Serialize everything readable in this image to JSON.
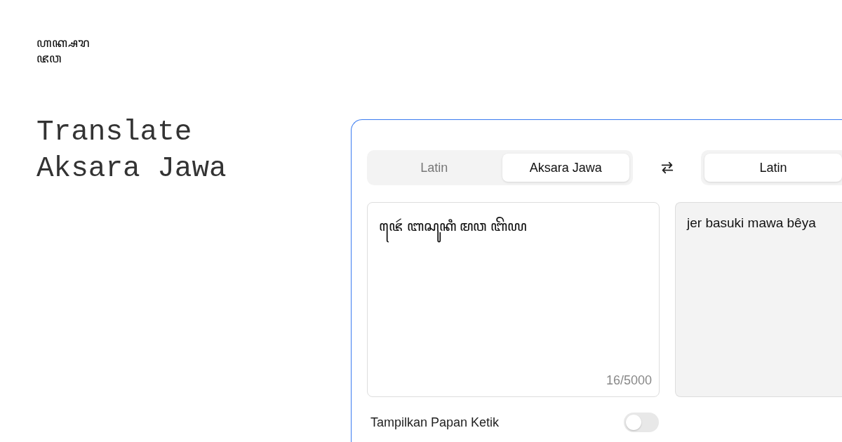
{
  "logo": {
    "line_1": "ꦲꦏ꧀ꦱꦫ",
    "line_2": "ꦗꦮ"
  },
  "headline": [
    "Translate",
    "Aksara Jawa"
  ],
  "source_tabs": [
    {
      "label": "Latin",
      "selected": false
    },
    {
      "label": "Aksara Jawa",
      "selected": true
    }
  ],
  "target_tabs": [
    {
      "label": "Latin",
      "selected": true
    }
  ],
  "input": {
    "value": "ꦗꦺꦂ ꦧꦱꦸꦏꦶ ꦩꦮ ꦧꦼꦪ",
    "counter": "16/5000"
  },
  "output": {
    "value": "jer basuki mawa bêya"
  },
  "keyboard_toggle": {
    "label": "Tampilkan Papan Ketik",
    "on": false
  }
}
